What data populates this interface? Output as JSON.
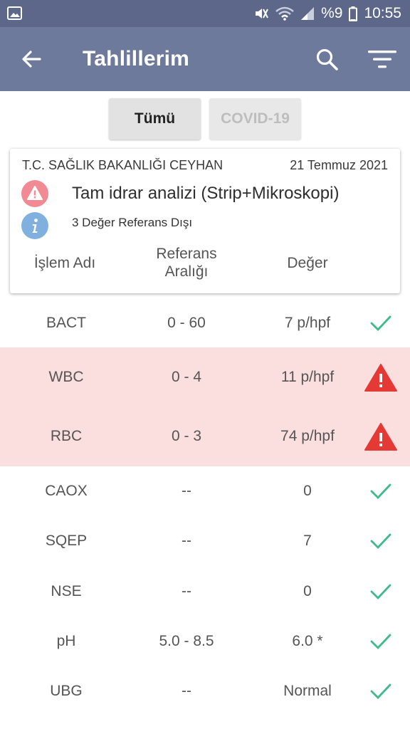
{
  "status_bar": {
    "battery_text": "%9",
    "time": "10:55"
  },
  "app_bar": {
    "title": "Tahlillerim",
    "back_icon": "back-arrow-icon",
    "search_icon": "search-icon",
    "filter_icon": "filter-icon"
  },
  "tabs": [
    {
      "label": "Tümü",
      "selected": true
    },
    {
      "label": "COVID-19",
      "selected": false
    }
  ],
  "card": {
    "institution": "T.C. SAĞLIK BAKANLIĞI CEYHAN",
    "date": "21 Temmuz 2021",
    "test_name": "Tam idrar analizi (Strip+Mikroskopi)",
    "out_of_range": "3 Değer Referans Dışı",
    "col_name": "İşlem Adı",
    "col_ref_line1": "Referans",
    "col_ref_line2": "Aralığı",
    "col_value": "Değer"
  },
  "colors": {
    "status_bar": "#5c6789",
    "app_bar": "#6e7a9c",
    "alert_row": "#fbdede",
    "ok_check": "#3dbb8a",
    "warn_red": "#e53935"
  },
  "results": [
    {
      "name": "BACT",
      "ref": "0 - 60",
      "value": "7 p/hpf",
      "status": "ok"
    },
    {
      "name": "WBC",
      "ref": "0 - 4",
      "value": "11 p/hpf",
      "status": "alert"
    },
    {
      "name": "RBC",
      "ref": "0 - 3",
      "value": "74 p/hpf",
      "status": "alert"
    },
    {
      "name": "CAOX",
      "ref": "--",
      "value": "0",
      "status": "ok"
    },
    {
      "name": "SQEP",
      "ref": "--",
      "value": "7",
      "status": "ok"
    },
    {
      "name": "NSE",
      "ref": "--",
      "value": "0",
      "status": "ok"
    },
    {
      "name": "pH",
      "ref": "5.0 - 8.5",
      "value": "6.0 *",
      "status": "ok"
    },
    {
      "name": "UBG",
      "ref": "--",
      "value": "Normal",
      "status": "ok"
    }
  ]
}
